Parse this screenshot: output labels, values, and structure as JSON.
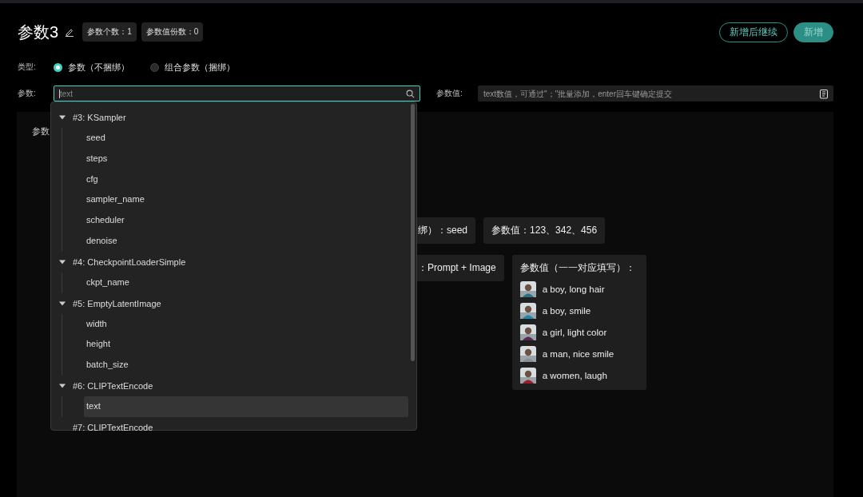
{
  "header": {
    "title": "参数3",
    "badges": [
      "参数个数：1",
      "参数值份数：0"
    ],
    "buttons": [
      {
        "label": "新增后继续",
        "kind": "outline"
      },
      {
        "label": "新增",
        "kind": "primary"
      }
    ]
  },
  "type_row": {
    "label": "类型:",
    "options": [
      {
        "label": "参数（不捆绑）",
        "selected": true
      },
      {
        "label": "组合参数（捆绑）",
        "selected": false
      }
    ]
  },
  "param_field": {
    "label": "参数:",
    "value": "text"
  },
  "value_field": {
    "label": "参数值:",
    "placeholder": "text数值，可通过\"；\"批量添加，enter回车键确定提交"
  },
  "dropdown": {
    "nodes": [
      {
        "label": "#3: KSampler",
        "expanded": true,
        "children": [
          {
            "label": "seed",
            "selected": false
          },
          {
            "label": "steps",
            "selected": false
          },
          {
            "label": "cfg",
            "selected": false
          },
          {
            "label": "sampler_name",
            "selected": false
          },
          {
            "label": "scheduler",
            "selected": false
          },
          {
            "label": "denoise",
            "selected": false
          }
        ]
      },
      {
        "label": "#4: CheckpointLoaderSimple",
        "expanded": true,
        "children": [
          {
            "label": "ckpt_name",
            "selected": false
          }
        ]
      },
      {
        "label": "#5: EmptyLatentImage",
        "expanded": true,
        "children": [
          {
            "label": "width",
            "selected": false
          },
          {
            "label": "height",
            "selected": false
          },
          {
            "label": "batch_size",
            "selected": false
          }
        ]
      },
      {
        "label": "#6: CLIPTextEncode",
        "expanded": true,
        "children": [
          {
            "label": "text",
            "selected": true
          }
        ]
      },
      {
        "label": "#7: CLIPTextEncode"
      }
    ]
  },
  "example": {
    "label": "参数",
    "row1": [
      "绑）：seed",
      "参数值：123、342、456"
    ],
    "row2": "：Prompt + Image",
    "values_title": "参数值（一一对应填写）：",
    "values": [
      {
        "label": "a boy, long hair",
        "color": "#2c6f80"
      },
      {
        "label": "a boy, smile",
        "color": "#1f86b0"
      },
      {
        "label": "a girl, light color",
        "color": "#5a2a55"
      },
      {
        "label": "a man, nice smile",
        "color": "#8a8f95"
      },
      {
        "label": "a women, laugh",
        "color": "#9a1f2a"
      }
    ]
  }
}
